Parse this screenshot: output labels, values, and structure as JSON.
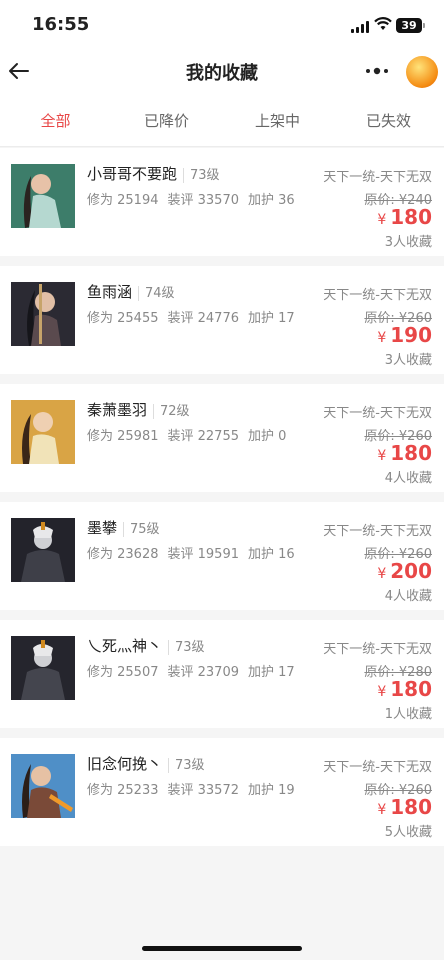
{
  "status_bar": {
    "time": "16:55",
    "battery": "39"
  },
  "nav": {
    "title": "我的收藏"
  },
  "tabs": [
    {
      "label": "全部",
      "active": true
    },
    {
      "label": "已降价",
      "active": false
    },
    {
      "label": "上架中",
      "active": false
    },
    {
      "label": "已失效",
      "active": false
    }
  ],
  "colors": {
    "accent": "#e84747",
    "muted": "#888888"
  },
  "items": [
    {
      "name": "小哥哥不要跑",
      "level": "73级",
      "cultivation": "修为 25194",
      "equip": "装评 33570",
      "protect": "加护 36",
      "server": "天下一统-天下无双",
      "original_price": "原价: ¥240",
      "currency": "¥",
      "price": "180",
      "favorites": "3人收藏"
    },
    {
      "name": "鱼雨涵",
      "level": "74级",
      "cultivation": "修为 25455",
      "equip": "装评 24776",
      "protect": "加护 17",
      "server": "天下一统-天下无双",
      "original_price": "原价: ¥260",
      "currency": "¥",
      "price": "190",
      "favorites": "3人收藏"
    },
    {
      "name": "秦萧墨羽",
      "level": "72级",
      "cultivation": "修为 25981",
      "equip": "装评 22755",
      "protect": "加护 0",
      "server": "天下一统-天下无双",
      "original_price": "原价: ¥260",
      "currency": "¥",
      "price": "180",
      "favorites": "4人收藏"
    },
    {
      "name": "墨攀",
      "level": "75级",
      "cultivation": "修为 23628",
      "equip": "装评 19591",
      "protect": "加护 16",
      "server": "天下一统-天下无双",
      "original_price": "原价: ¥260",
      "currency": "¥",
      "price": "200",
      "favorites": "4人收藏"
    },
    {
      "name": "乀死灬神丶",
      "level": "73级",
      "cultivation": "修为 25507",
      "equip": "装评 23709",
      "protect": "加护 17",
      "server": "天下一统-天下无双",
      "original_price": "原价: ¥280",
      "currency": "¥",
      "price": "180",
      "favorites": "1人收藏"
    },
    {
      "name": "旧念何挽丶",
      "level": "73级",
      "cultivation": "修为 25233",
      "equip": "装评 33572",
      "protect": "加护 19",
      "server": "天下一统-天下无双",
      "original_price": "原价: ¥260",
      "currency": "¥",
      "price": "180",
      "favorites": "5人收藏"
    }
  ]
}
